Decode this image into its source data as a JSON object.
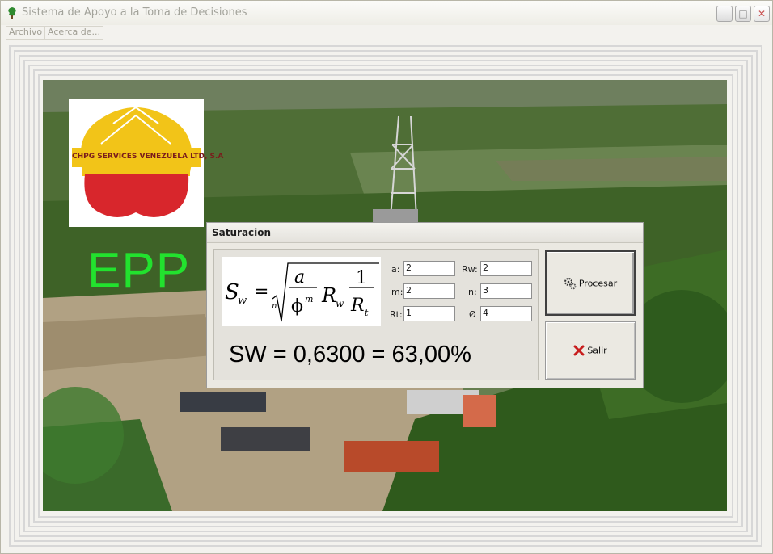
{
  "window": {
    "title": "Sistema de Apoyo a la Toma de Decisiones",
    "controls": {
      "minimize": "_",
      "maximize": "□",
      "close": "✕"
    }
  },
  "menu": {
    "items": [
      "Archivo",
      "Acerca de..."
    ]
  },
  "background": {
    "logo_text": "CHPG SERVICES VENEZUELA LTD, S.A",
    "brand_label": "EPP"
  },
  "dialog": {
    "title": "Saturacion",
    "fields": {
      "a": {
        "label": "a:",
        "value": "2"
      },
      "rw": {
        "label": "Rw:",
        "value": "2"
      },
      "m": {
        "label": "m:",
        "value": "2"
      },
      "n": {
        "label": "n:",
        "value": "3"
      },
      "rt": {
        "label": "Rt:",
        "value": "1"
      },
      "phi": {
        "label": "Ø",
        "value": "4"
      }
    },
    "result": "SW = 0,6300 = 63,00%",
    "buttons": {
      "process": "Procesar",
      "exit": "Salir"
    }
  },
  "colors": {
    "brand_green": "#22e22e",
    "logo_yellow": "#f2c418",
    "logo_red": "#d8262c",
    "exit_icon": "#c81e1e"
  },
  "icons": {
    "process": "gears-icon",
    "exit": "x-icon",
    "app": "tree-icon"
  }
}
